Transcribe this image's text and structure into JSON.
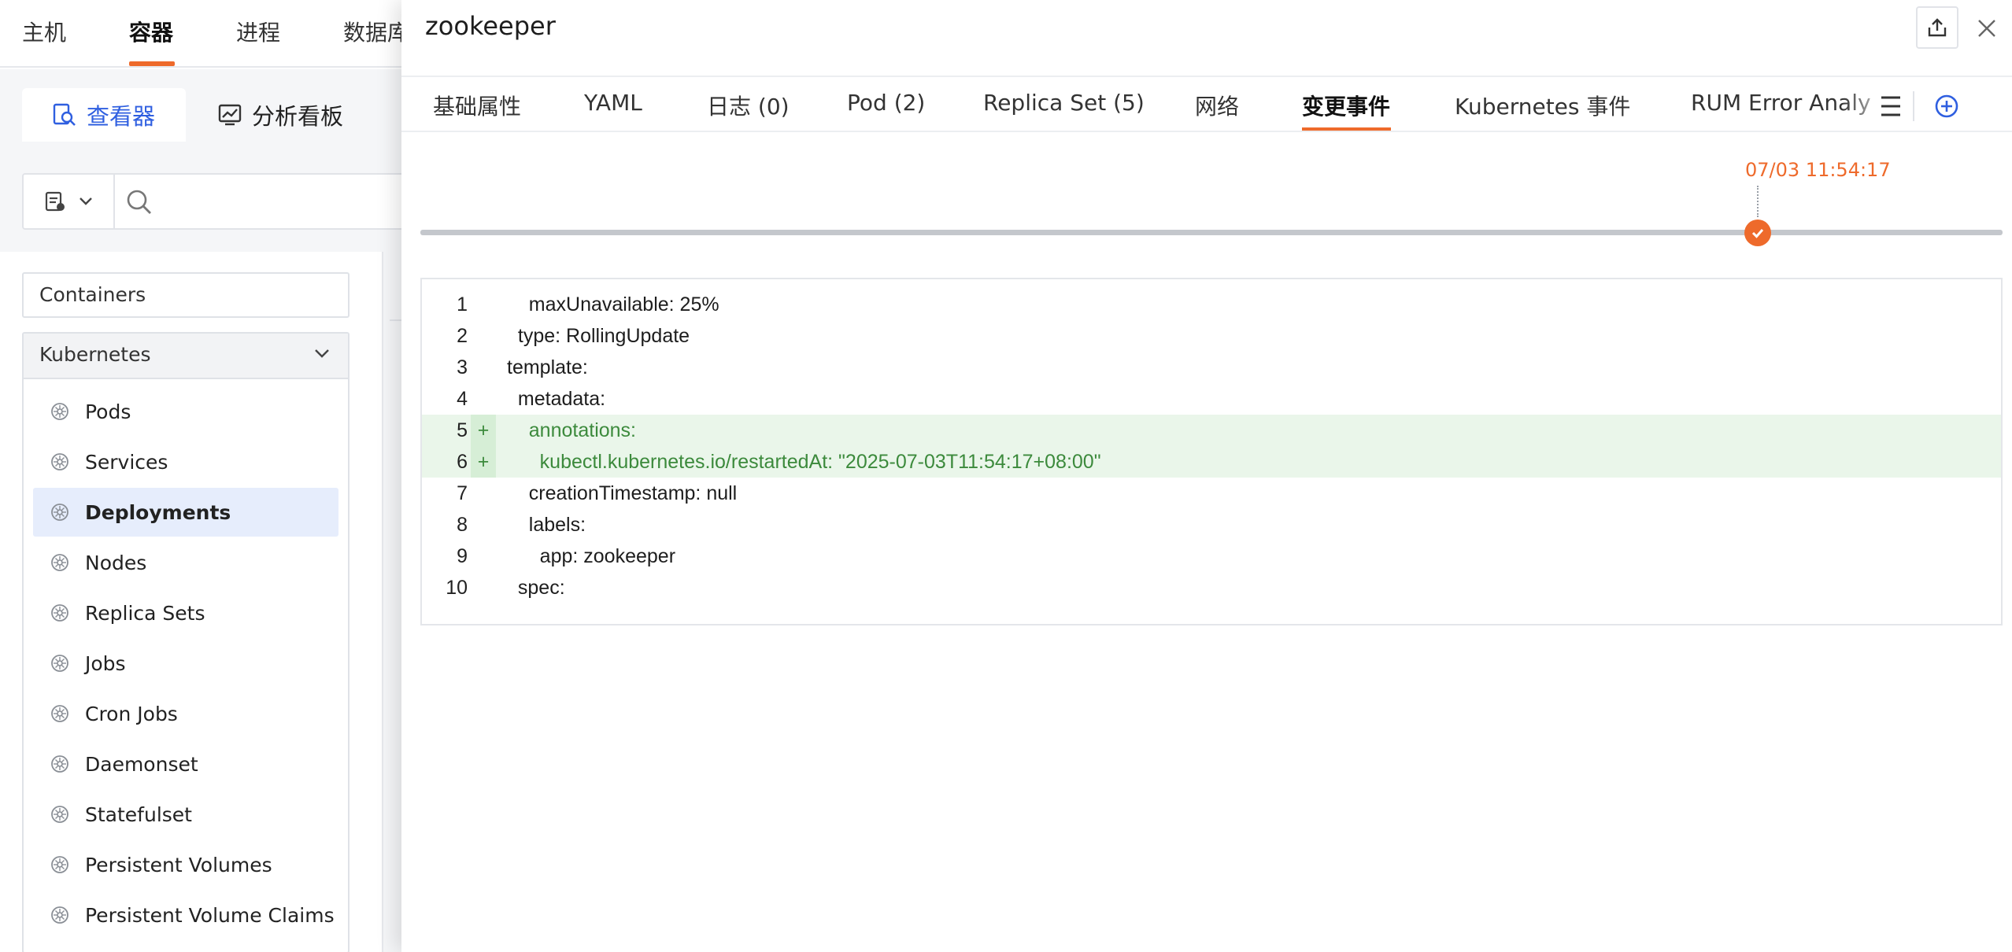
{
  "topnav": {
    "items": [
      "主机",
      "容器",
      "进程",
      "数据库"
    ],
    "active": "容器"
  },
  "subtabs": {
    "viewer": "查看器",
    "dashboard": "分析看板"
  },
  "sidebar": {
    "containers_label": "Containers",
    "kubernetes_label": "Kubernetes",
    "items": [
      {
        "label": "Pods"
      },
      {
        "label": "Services"
      },
      {
        "label": "Deployments"
      },
      {
        "label": "Nodes"
      },
      {
        "label": "Replica Sets"
      },
      {
        "label": "Jobs"
      },
      {
        "label": "Cron Jobs"
      },
      {
        "label": "Daemonset"
      },
      {
        "label": "Statefulset"
      },
      {
        "label": "Persistent Volumes"
      },
      {
        "label": "Persistent Volume Claims"
      }
    ],
    "selected": "Deployments"
  },
  "drawer": {
    "title": "zookeeper",
    "tabs": [
      {
        "label": "基础属性"
      },
      {
        "label": "YAML"
      },
      {
        "label": "日志 (0)"
      },
      {
        "label": "Pod (2)"
      },
      {
        "label": "Replica Set (5)"
      },
      {
        "label": "网络"
      },
      {
        "label": "变更事件"
      },
      {
        "label": "Kubernetes 事件"
      },
      {
        "label": "RUM Error Analy"
      }
    ],
    "active_tab": "变更事件",
    "timeline": {
      "event_time": "07/03 11:54:17"
    },
    "diff": [
      {
        "n": "1",
        "marker": "",
        "text": "    maxUnavailable: 25%",
        "added": false
      },
      {
        "n": "2",
        "marker": "",
        "text": "  type: RollingUpdate",
        "added": false
      },
      {
        "n": "3",
        "marker": "",
        "text": "template:",
        "added": false
      },
      {
        "n": "4",
        "marker": "",
        "text": "  metadata:",
        "added": false
      },
      {
        "n": "5",
        "marker": "+",
        "text": "    annotations:",
        "added": true
      },
      {
        "n": "6",
        "marker": "+",
        "text": "      kubectl.kubernetes.io/restartedAt: \"2025-07-03T11:54:17+08:00\"",
        "added": true
      },
      {
        "n": "7",
        "marker": "",
        "text": "    creationTimestamp: null",
        "added": false
      },
      {
        "n": "8",
        "marker": "",
        "text": "    labels:",
        "added": false
      },
      {
        "n": "9",
        "marker": "",
        "text": "      app: zookeeper",
        "added": false
      },
      {
        "n": "10",
        "marker": "",
        "text": "  spec:",
        "added": false
      }
    ]
  },
  "colors": {
    "accent": "#ee6a2b",
    "primary": "#2f5fe0",
    "added_bg": "#eaf6ea",
    "added_text": "#3c8a3c",
    "selected_bg": "#e6edfc"
  },
  "icons": {
    "viewer": "magnifier-doc-icon",
    "dashboard": "chart-board-icon",
    "share": "share-upload-icon",
    "close": "close-icon",
    "menu": "menu-icon",
    "add": "plus-circle-icon",
    "k8s": "kubernetes-helm-icon"
  }
}
